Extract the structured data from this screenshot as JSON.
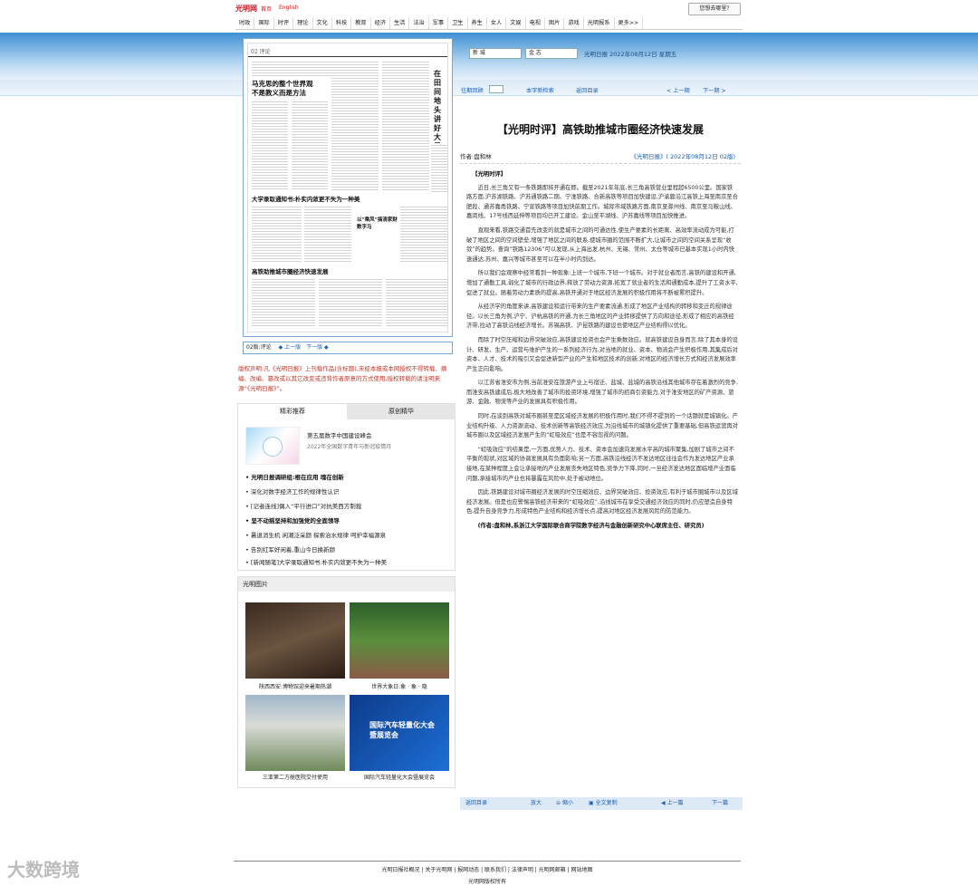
{
  "top": {
    "logo": "光明网",
    "home": "首页",
    "english": "English",
    "where_button": "您想去哪里?"
  },
  "nav": [
    "时政",
    "国际",
    "时评",
    "理论",
    "文化",
    "科技",
    "教育",
    "经济",
    "生活",
    "法治",
    "军事",
    "卫生",
    "养生",
    "女人",
    "文娱",
    "电视",
    "图片",
    "游戏",
    "光明报系",
    "更多>>"
  ],
  "paper": {
    "page_label": "02 评论",
    "headline1": "马克思的整个世界观不是教义而是方法",
    "headline_right": "在田间地头讲好大思政课",
    "headline2": "大学录取通知书:朴实内敛更不失为一种美",
    "headline3": "高铁助推城市圈经济快速发展",
    "headline4": "以“乘风”搞清家财数字马",
    "nav_label": "02版:评论",
    "prev": "上一版",
    "next": "下一版"
  },
  "copyright": "版权声明:凡《光明日报》上刊载作品(含标题),未经本报或本网授权不得转载、摘编、改编、篡改或以其它改变或违背作者原意的方式使用,授权转载的请注明来源“《光明日报》”。",
  "recommend": {
    "tab1": "精彩推荐",
    "tab2": "原创精华",
    "promo_title": "第五届数字中国建设峰会",
    "promo_sub": "2022年全国数字青年与新冠疫情月",
    "items": [
      "光明日报调研组:根在应用 魂在创新",
      "深化对数字经济工作的规律性认识",
      "[记者连线]偶入“平行进口”对抗美西方制裁",
      "坚不动摇坚持和加强党的全面领导",
      "暑退消生机 闲潮泛采颜 探索治水规律 呵护幸福源泉",
      "告别红军好闲着,重山今日换新颜",
      "[新闻随笔]大学录取通知书:朴实内敛更不失为一种美"
    ]
  },
  "photos": {
    "title": "光明图片",
    "items": [
      {
        "caption": "陕西西安:博物馆迎来暑期热潮"
      },
      {
        "caption": "世界大象日:象 · 象 · 隐"
      },
      {
        "caption": "三亚第二方舱医院交付使用"
      },
      {
        "caption": "国际汽车轻量化大会暨展览会"
      }
    ],
    "poster_text": "国际汽车轻量化大会 暨展览会"
  },
  "edition": {
    "sel1": "新  城",
    "sel2": "金  志",
    "date_text": "光明日报 2022年08月12日 星期五"
  },
  "subbar": {
    "past": "往期回顾",
    "search": "本字新检索",
    "back_dir": "返回目录",
    "prev": "< 上一期",
    "next": "下一期 >"
  },
  "article": {
    "title": "【光明时评】高铁助推城市圈经济快速发展",
    "author": "作者:盘和林",
    "source": "《光明日报》( 2022年08月12日 02版)",
    "tag": "【光明时评】",
    "paragraphs": [
      "近日,长三角又有一条铁路即将开通在即。截至2021年年底,长三角高铁营业里程超6500公里。国家铁路方面,沪苏湖铁路、沪苏通铁路二期、宁淮铁路、合新高铁等项目加快建设,沪渝蓉沿江高铁上海至南京至合肥段、通苏嘉甬铁路、宁宣铁路等项目加快前期工作。城际市域铁路方面,南京至滁州线、南京至马鞍山线、嘉闵线、17号线西延伸等项目均已开工建设。金山至平湖线、沪苏嘉线等项目加快推进。",
      "直观来看,铁路交通首先改变的就是城市之间的可通达性,使生产要素的长距离、高效率流动成为可能,打破了地区之间的空间壁垒,增强了地区之间的联系,使城市圈的范围不断扩大,让城市之间的空间关系呈现“收敛”的趋势。查询“铁路12306”可以发现,从上海出发,杭州、无锡、常州、太仓等城市已基本实现1小时内快速通达,苏州、嘉兴等城市甚至可以在半小时内到达。",
      "所以我们会观察中经常看到一种现象:上班一个城市,下班一个城市。对于就业者而言,高铁的建设和开通,增加了通勤工具,弱化了城市的行政边界,释放了劳动力资源,拓宽了就业者的生活和通勤成本,提升了工资水平,促进了就业。随着劳动力素质的提高,高铁开通对于地区经济发展的积极作用将不断被累积提升。",
      "从经济学的角度来讲,高铁建设和运行带来的生产要素流通,形成了地区产业结构的转移和变迁的规律途径。以长三角为例,沪宁、沪杭高铁的开通,为长三角地区的产业转移提供了方向和途径,形成了相应的高铁经济带,拉动了高铁沿线经济增长。苏锡高铁、沪昆铁路的建设也使地区产业结构得以优化。",
      "而除了时空压缩和边界突破效应,高铁建设投资也会产生乘数效应。就高铁建设自身而言,除了其本身的设计、研发、生产、运营与维护产生的一系列经济行为,对当地的就业、资本、物流会产生积极作用,其集成后对资本、人才、技术的吸引又会促进新型产业的产生和地区技术的创新,对地区的经济增长方式和经济发展效率产生正向影响。",
      "以江苏省淮安市为例,当前淮安在旅游产业上与宿迁、盐城、盐城的高铁沿线其他城市存在着激烈的竞争,而淮安高铁建成后,极大地改善了城市的投资环境,增强了城市的招商引资能力,对于淮安地区的矿产资源、旅游、金融、物流等产业的发展具有积极作用。",
      "同时,在谈到高铁对城市圈甚至是区域经济发展的积极作用时,我们不得不提到的一个话题就是城镇化。产业结构升级、人力资源流动、技术创新等高铁经济效应,为沿线城市的城镇化提供了重要基础,但高铁运营再对城市圈以及区域经济发展产生的“虹吸效应”也是不容忽视的问题。",
      "“虹吸效应”的结果是,一方面,优势人力、技术、资本会加速向发展水平高的城市聚集,加剧了城市之间不平衡的现状,对区域的协调发展具有负面影响;另一方面,高铁沿线经济不发达地区往往会作为发达地区产业承接地,在某种程度上会让承接地的产业发展丧失地区特色,竞争力下降,同时,一旦经济发达地区面临增产业面临问题,承接城市的产业也将暴露在风险中,处于被动地位。",
      "因此,铁路建设对城市圈经济发展的时空压缩效应、边界突破效应、投资效应,有利于城市圈城市以及区域经济发展。但是也应警惕高铁经济带来的“虹吸效应”,沿线城市在享受交通经济效应的同时,仍应塑造自身特色,提升自身竞争力,形成特色产业结构和经济增长点,提高对地区经济发展风险的防范能力。"
    ],
    "author_note": "(作者:盘和林,系浙江大学国际联合商学院数字经济与金融创新研究中心联席主任、研究员)"
  },
  "bottombar": {
    "back": "返回目录",
    "zoom_in": "放大",
    "zoom_out": "缩小",
    "fulltext": "全文复制",
    "prev": "上一篇",
    "next": "下一篇"
  },
  "footer": {
    "links": "光明日报社概况 | 关于光明网 | 报网动态 | 联系我们 | 法律声明 | 光明网邮箱 | 网站地图",
    "copyright": "光明网版权所有"
  },
  "watermark": "大数跨境"
}
